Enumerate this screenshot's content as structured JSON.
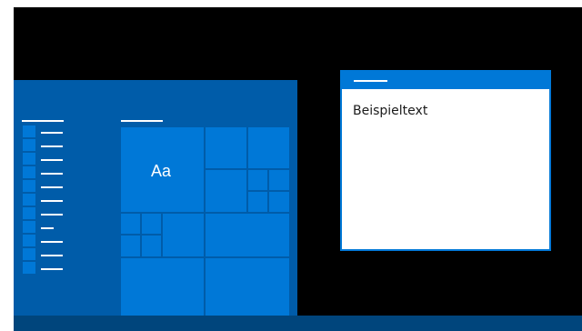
{
  "start_menu": {
    "tile_sample_label": "Aa"
  },
  "app_window": {
    "content_text": "Beispieltext"
  },
  "colors": {
    "accent": "#0078d7",
    "start_menu_background": "#005ca9",
    "taskbar": "#00457c",
    "desktop": "#000000"
  }
}
